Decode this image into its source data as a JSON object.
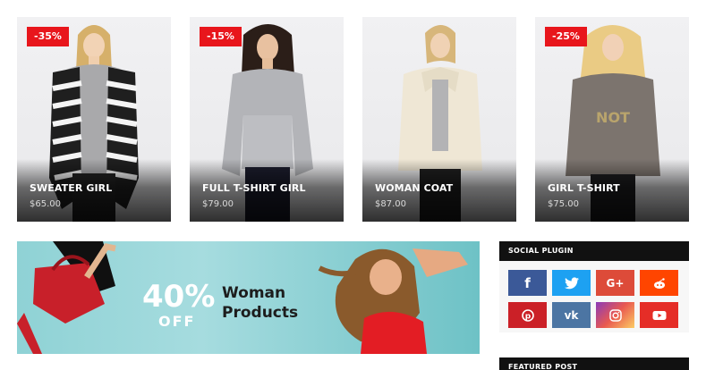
{
  "products": [
    {
      "badge": "-35%",
      "name": "SWEATER GIRL",
      "price": "$65.00"
    },
    {
      "badge": "-15%",
      "name": "FULL T-SHIRT GIRL",
      "price": "$79.00"
    },
    {
      "badge": "",
      "name": "WOMAN COAT",
      "price": "$87.00"
    },
    {
      "badge": "-25%",
      "name": "GIRL T-SHIRT",
      "price": "$75.00"
    }
  ],
  "banner": {
    "percent": "40%",
    "off": "OFF",
    "line1": "Woman",
    "line2": "Products"
  },
  "social": {
    "title": "SOCIAL PLUGIN",
    "buttons": [
      {
        "icon": "facebook-icon",
        "glyph": "f",
        "color": "#3b5998"
      },
      {
        "icon": "twitter-icon",
        "glyph": "🐦",
        "color": "#1da1f2"
      },
      {
        "icon": "google-plus-icon",
        "glyph": "G+",
        "color": "#dd4b39"
      },
      {
        "icon": "reddit-icon",
        "glyph": "👽",
        "color": "#ff4500"
      },
      {
        "icon": "pinterest-icon",
        "glyph": "P",
        "color": "#cb2027"
      },
      {
        "icon": "vk-icon",
        "glyph": "vk",
        "color": "#4c75a3"
      },
      {
        "icon": "instagram-icon",
        "glyph": "◎",
        "color": "#c13584"
      },
      {
        "icon": "youtube-icon",
        "glyph": "▶",
        "color": "#e52d27"
      }
    ]
  },
  "featured": {
    "title": "FEATURED POST"
  },
  "colors": {
    "accent": "#e8161c",
    "widget_header": "#111111",
    "banner_bg": "#8fd2d5"
  }
}
